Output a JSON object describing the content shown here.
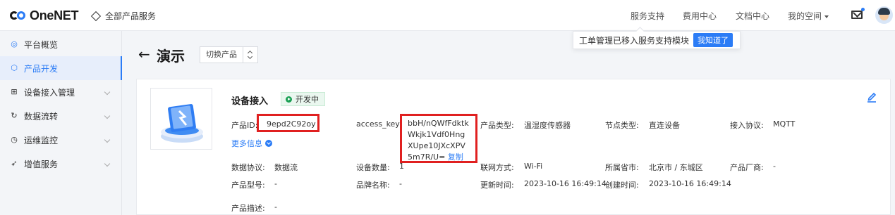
{
  "topbar": {
    "brand": "OneNET",
    "all_products": "全部产品服务",
    "nav": [
      "服务支持",
      "费用中心",
      "文档中心",
      "我的空间"
    ]
  },
  "notice": {
    "text": "工单管理已移入服务支持模块",
    "button": "我知道了"
  },
  "sidebar": {
    "items": [
      {
        "label": "平台概览",
        "icon": "dashboard-icon"
      },
      {
        "label": "产品开发",
        "icon": "product-cube-icon"
      },
      {
        "label": "设备接入管理",
        "icon": "device-icon"
      },
      {
        "label": "数据流转",
        "icon": "flow-icon"
      },
      {
        "label": "运维监控",
        "icon": "monitor-icon"
      },
      {
        "label": "增值服务",
        "icon": "rocket-icon"
      }
    ]
  },
  "page": {
    "title": "演示",
    "switch_label": "切换产品"
  },
  "card": {
    "section_title": "设备接入",
    "status": "开发中",
    "product_id_label": "产品ID:",
    "product_id": "9epd2C92oy",
    "access_key_label": "access_key:",
    "access_key": "bbH/nQWfFdktkWkjk1Vdf0HngXUpe10JXcXPV5m7R/U=",
    "copy": "复制",
    "product_type_label": "产品类型:",
    "product_type": "温湿度传感器",
    "node_type_label": "节点类型:",
    "node_type": "直连设备",
    "protocol_label": "接入协议:",
    "protocol": "MQTT",
    "more_info": "更多信息",
    "data_protocol_label": "数据协议:",
    "data_protocol": "数据流",
    "device_count_label": "设备数量:",
    "device_count": "1",
    "network_label": "联网方式:",
    "network": "Wi-Fi",
    "province_label": "所属省市:",
    "province": "北京市 / 东城区",
    "vendor_label": "产品厂商:",
    "vendor": "-",
    "model_label": "产品型号:",
    "model": "-",
    "brand_label": "品牌名称:",
    "brand": "-",
    "updated_label": "更新时间:",
    "updated": "2023-10-16 16:49:14",
    "created_label": "创建时间:",
    "created": "2023-10-16 16:49:14",
    "desc_label": "产品描述:",
    "desc": "-"
  },
  "colors": {
    "accent": "#2b7cf6",
    "highlight_box": "#e02020",
    "status_green": "#1aa053"
  }
}
